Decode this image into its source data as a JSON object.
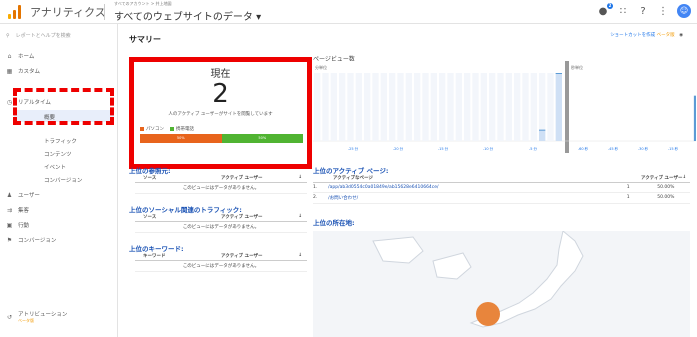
{
  "header": {
    "app_name": "アナリティクス",
    "breadcrumb_small": "すべてのアカウント > 井上地図",
    "account_title": "すべてのウェブサイトのデータ ▾",
    "notification_count": "2"
  },
  "sidebar": {
    "search_placeholder": "レポートとヘルプを検索",
    "items": [
      {
        "label": "ホーム"
      },
      {
        "label": "カスタム"
      },
      {
        "label": "リアルタイム"
      },
      {
        "label": "概要"
      },
      {
        "label": "トラフィック"
      },
      {
        "label": "コンテンツ"
      },
      {
        "label": "イベント"
      },
      {
        "label": "コンバージョン"
      },
      {
        "label": "ユーザー"
      },
      {
        "label": "集客"
      },
      {
        "label": "行動"
      },
      {
        "label": "コンバージョン"
      }
    ],
    "attribution": "アトリビューション",
    "beta": "ベータ版"
  },
  "main": {
    "title": "サマリー",
    "shortcut_label": "ショートカットを作成",
    "shortcut_beta": "ベータ版",
    "now": {
      "label": "現在",
      "value": "2",
      "description": "人のアクティブ ユーザーがサイトを閲覧しています",
      "legend_pc": "パソコン",
      "legend_mobile": "携帯電話",
      "pc_pct": "50%",
      "mobile_pct": "50%"
    },
    "pageviews": {
      "title": "ページビュー数",
      "left_sub": "分単位",
      "right_sub": "秒単位"
    },
    "referrals": {
      "title": "上位の参照元:",
      "col1": "ソース",
      "col2": "アクティブ ユーザー",
      "nodata": "このビューにはデータがありません。"
    },
    "social": {
      "title": "上位のソーシャル関連のトラフィック:",
      "col1": "ソース",
      "col2": "アクティブ ユーザー",
      "nodata": "このビューにはデータがありません。"
    },
    "keywords": {
      "title": "上位のキーワード:",
      "col1": "キーワード",
      "col2": "アクティブ ユーザー",
      "nodata": "このビューにはデータがありません。"
    },
    "active_pages": {
      "title": "上位のアクティブ ページ:",
      "col1": "アクティブなページ",
      "col2": "アクティブ ユーザー",
      "rows": [
        {
          "num": "1.",
          "page": "/app/ab3d0554c0a01849e/ab15628e6410664ce/",
          "users": "1",
          "pct": "50.00%"
        },
        {
          "num": "2.",
          "page": "/お問い合わせ/",
          "users": "1",
          "pct": "50.00%"
        }
      ]
    },
    "location": {
      "title": "上位の所在地:"
    }
  },
  "colors": {
    "accent_red": "#e00000",
    "pc_orange": "#e8641c",
    "mobile_green": "#50b432",
    "link_blue": "#1a52b4",
    "bar_blue": "#5b9bd5",
    "map_dot": "#e8853c"
  },
  "chart_data": {
    "type": "bar",
    "title": "ページビュー数",
    "series": [
      {
        "name": "分単位",
        "x_labels": [
          "-25 分",
          "-20 分",
          "-15 分",
          "-10 分",
          "-5 分"
        ],
        "values": [
          0,
          0,
          0,
          0,
          0,
          0,
          0,
          0,
          0,
          0,
          0,
          0,
          0,
          0,
          0,
          0,
          0,
          0,
          0,
          0,
          0,
          0,
          0,
          0,
          0,
          0,
          0,
          1,
          0,
          6
        ]
      },
      {
        "name": "秒単位",
        "x_labels": [
          "-60 秒",
          "-45 秒",
          "-30 秒",
          "-15 秒"
        ],
        "values": [
          0,
          0,
          0,
          0,
          0,
          0,
          0,
          0,
          0,
          0,
          0,
          0,
          0,
          0,
          0,
          0,
          0,
          0,
          0,
          0,
          0,
          0,
          0,
          0,
          0,
          0,
          0,
          0,
          0,
          0,
          0,
          0,
          0,
          0,
          0,
          0,
          0,
          0,
          0,
          0,
          0,
          0,
          0,
          0,
          0,
          0,
          0,
          0,
          0,
          0,
          0,
          0,
          0,
          0,
          0,
          0,
          0,
          0,
          4
        ]
      }
    ]
  }
}
